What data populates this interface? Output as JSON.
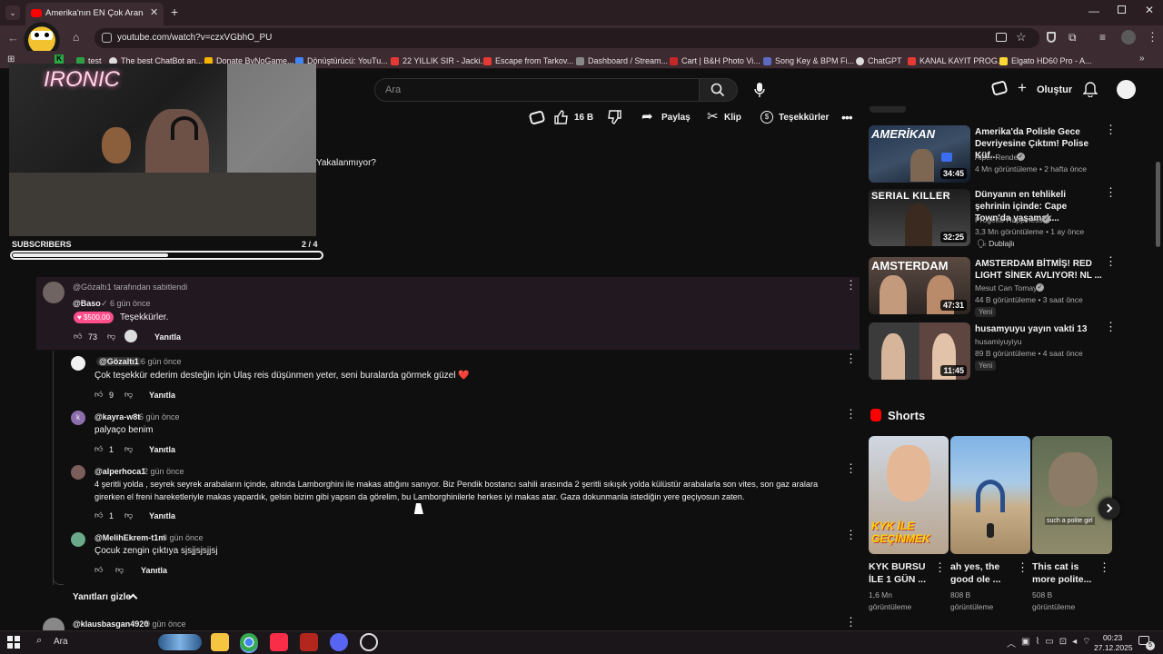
{
  "browser": {
    "tab_title": "Amerika'nın EN Çok Aranan Süı",
    "url": "youtube.com/watch?v=czxVGbhO_PU",
    "bookmarks": [
      "test",
      "The best ChatBot an...",
      "Donate ByNoGame...",
      "Dönüştürücü: YouTu...",
      "22 YILLIK SIR - Jacki...",
      "Escape from Tarkov...",
      "Dashboard / Stream...",
      "Cart | B&H Photo Vi...",
      "Song Key & BPM Fi...",
      "ChatGPT",
      "KANAL KAYIT PROG...",
      "Elgato HD60 Pro - A..."
    ]
  },
  "header": {
    "search_placeholder": "Ara",
    "create_label": "Oluştur"
  },
  "video": {
    "overlay_logo": "IRONIC",
    "subtitle": "Yakalanmıyor?",
    "subscribers_label": "SUBSCRIBERS",
    "subscribers_count": "2 / 4",
    "subscribers_progress": 0.5,
    "like_count": "16 B",
    "share_label": "Paylaş",
    "clip_label": "Klip",
    "thanks_label": "Teşekkürler"
  },
  "comments": {
    "pinned_by": "@Gözaltı1 tarafından sabitlendi",
    "pinned": {
      "user": "@Baso",
      "time": "6 gün önce",
      "superthanks": "$500,00",
      "text": "Teşekkürler.",
      "likes": "73",
      "reply": "Yanıtla"
    },
    "replies": [
      {
        "user": "@Gözaltı1",
        "time": "6 gün önce",
        "text": "Çok teşekkür ederim desteğin için Ulaş reis düşünmen yeter, seni buralarda görmek güzel ❤️",
        "likes": "9",
        "reply": "Yanıtla"
      },
      {
        "user": "@kayra-w8t",
        "time": "6 gün önce",
        "text": "palyaço benim",
        "likes": "1",
        "reply": "Yanıtla"
      },
      {
        "user": "@alperhoca1",
        "time": "2 gün önce",
        "text1": "4 şeritli yolda , seyrek seyrek arabaların içinde, altında Lamborghini ile makas attığını sanıyor. Biz Pendik bostancı sahili arasında 2 şeritli sıkışık yolda külüstür arabalarla son vites, son gaz aralara",
        "text2": "girerken el freni hareketleriyle makas yapardık, gelsin bizim gibi yapsın da görelim, bu Lamborghinilerle herkes iyi makas atar. Gaza dokunmanla istediğin yere geçiyosun zaten.",
        "likes": "1",
        "reply": "Yanıtla"
      },
      {
        "user": "@MelihEkrem-t1m",
        "time": "3 gün önce",
        "text": "Çocuk zengin çıktıya sjsjjsjsjjsj",
        "likes": "",
        "reply": "Yanıtla"
      }
    ],
    "hide_replies": "Yanıtları gizle",
    "next": {
      "user": "@klausbasgan4920",
      "time": "9 gün önce"
    }
  },
  "sidebar": {
    "videos": [
      {
        "title": "Amerika'da Polisle Gece Devriyesine Çıktım! Polise Küf...",
        "channel": "Alper Rende",
        "meta": "4 Mn görüntüleme  •  2 hafta önce",
        "duration": "34:45",
        "thumb_text": "AMERİKAN",
        "badge": ""
      },
      {
        "title": "Dünyanın en tehlikeli şehrinin içinde: Cape Town'da yaşamak...",
        "channel": "Progetto Happiness",
        "meta": "3,3 Mn görüntüleme  •  1 ay önce",
        "duration": "32:25",
        "thumb_text": "SERIAL KILLER",
        "badge": "Dublajlı"
      },
      {
        "title": "AMSTERDAM BİTMİŞ! RED LIGHT SİNEK AVLIYOR! NL ...",
        "channel": "Mesut Can Tomay",
        "meta": "44 B görüntüleme  •  3 saat önce",
        "duration": "47:31",
        "thumb_text": "AMSTERDAM",
        "badge": "Yeni"
      },
      {
        "title": "husamyuyu yayın vakti 13",
        "channel": "husamiyuyiyu",
        "meta": "89 B görüntüleme  •  4 saat önce",
        "duration": "11:45",
        "thumb_text": "",
        "badge": "Yeni"
      }
    ],
    "shorts_label": "Shorts",
    "shorts": [
      {
        "title1": "KYK BURSU",
        "title2": "İLE 1 GÜN ...",
        "views1": "1,6 Mn",
        "views2": "görüntüleme",
        "thumb_text": "KYK İLE GEÇİNMEK"
      },
      {
        "title1": "ah yes, the",
        "title2": "good ole ...",
        "views1": "808 B",
        "views2": "görüntüleme",
        "thumb_text": ""
      },
      {
        "title1": "This cat is",
        "title2": "more polite...",
        "views1": "508 B",
        "views2": "görüntüleme",
        "thumb_text": "such a polite girl"
      }
    ]
  },
  "taskbar": {
    "search": "Ara",
    "time": "00:23",
    "date": "27.12.2025",
    "notif": "5"
  }
}
